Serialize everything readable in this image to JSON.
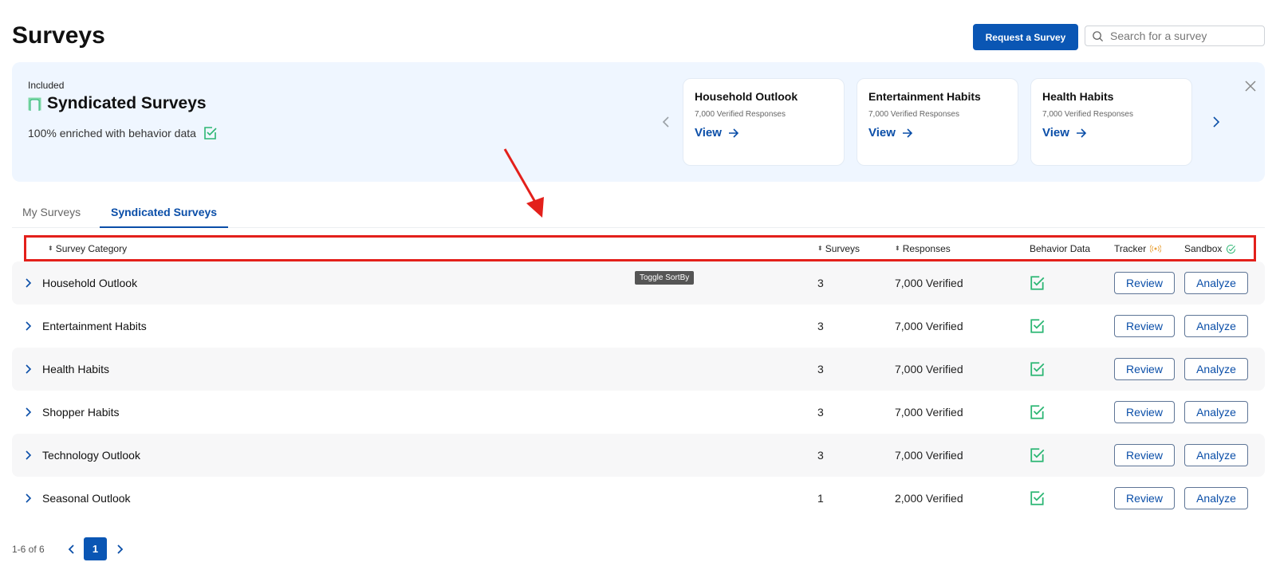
{
  "page": {
    "title": "Surveys"
  },
  "header": {
    "request_button": "Request a Survey",
    "search_placeholder": "Search for a survey",
    "search_value": ""
  },
  "banner": {
    "eyebrow": "Included",
    "title": "Syndicated Surveys",
    "subtitle": "100% enriched with behavior data",
    "cards": [
      {
        "title": "Household Outlook",
        "sub": "7,000 Verified Responses",
        "link": "View"
      },
      {
        "title": "Entertainment Habits",
        "sub": "7,000 Verified Responses",
        "link": "View"
      },
      {
        "title": "Health Habits",
        "sub": "7,000 Verified Responses",
        "link": "View"
      }
    ]
  },
  "tabs": [
    {
      "label": "My Surveys",
      "active": false
    },
    {
      "label": "Syndicated Surveys",
      "active": true
    }
  ],
  "table": {
    "headers": {
      "category": "Survey Category",
      "surveys": "Surveys",
      "responses": "Responses",
      "behavior": "Behavior Data",
      "tracker": "Tracker",
      "sandbox": "Sandbox"
    },
    "tooltip": "Toggle SortBy",
    "review_label": "Review",
    "analyze_label": "Analyze",
    "rows": [
      {
        "name": "Household Outlook",
        "surveys": "3",
        "responses": "7,000 Verified",
        "behavior_data": true
      },
      {
        "name": "Entertainment Habits",
        "surveys": "3",
        "responses": "7,000 Verified",
        "behavior_data": true
      },
      {
        "name": "Health Habits",
        "surveys": "3",
        "responses": "7,000 Verified",
        "behavior_data": true
      },
      {
        "name": "Shopper Habits",
        "surveys": "3",
        "responses": "7,000 Verified",
        "behavior_data": true
      },
      {
        "name": "Technology Outlook",
        "surveys": "3",
        "responses": "7,000 Verified",
        "behavior_data": true
      },
      {
        "name": "Seasonal Outlook",
        "surveys": "1",
        "responses": "2,000 Verified",
        "behavior_data": true
      }
    ]
  },
  "pagination": {
    "range": "1-6 of 6",
    "current_page": "1"
  },
  "colors": {
    "primary": "#0a56b4",
    "link": "#0a4ea8",
    "success": "#2bb673",
    "tracker": "#e8a33d",
    "banner_bg": "#eff6ff",
    "annotation": "#e3201b"
  }
}
